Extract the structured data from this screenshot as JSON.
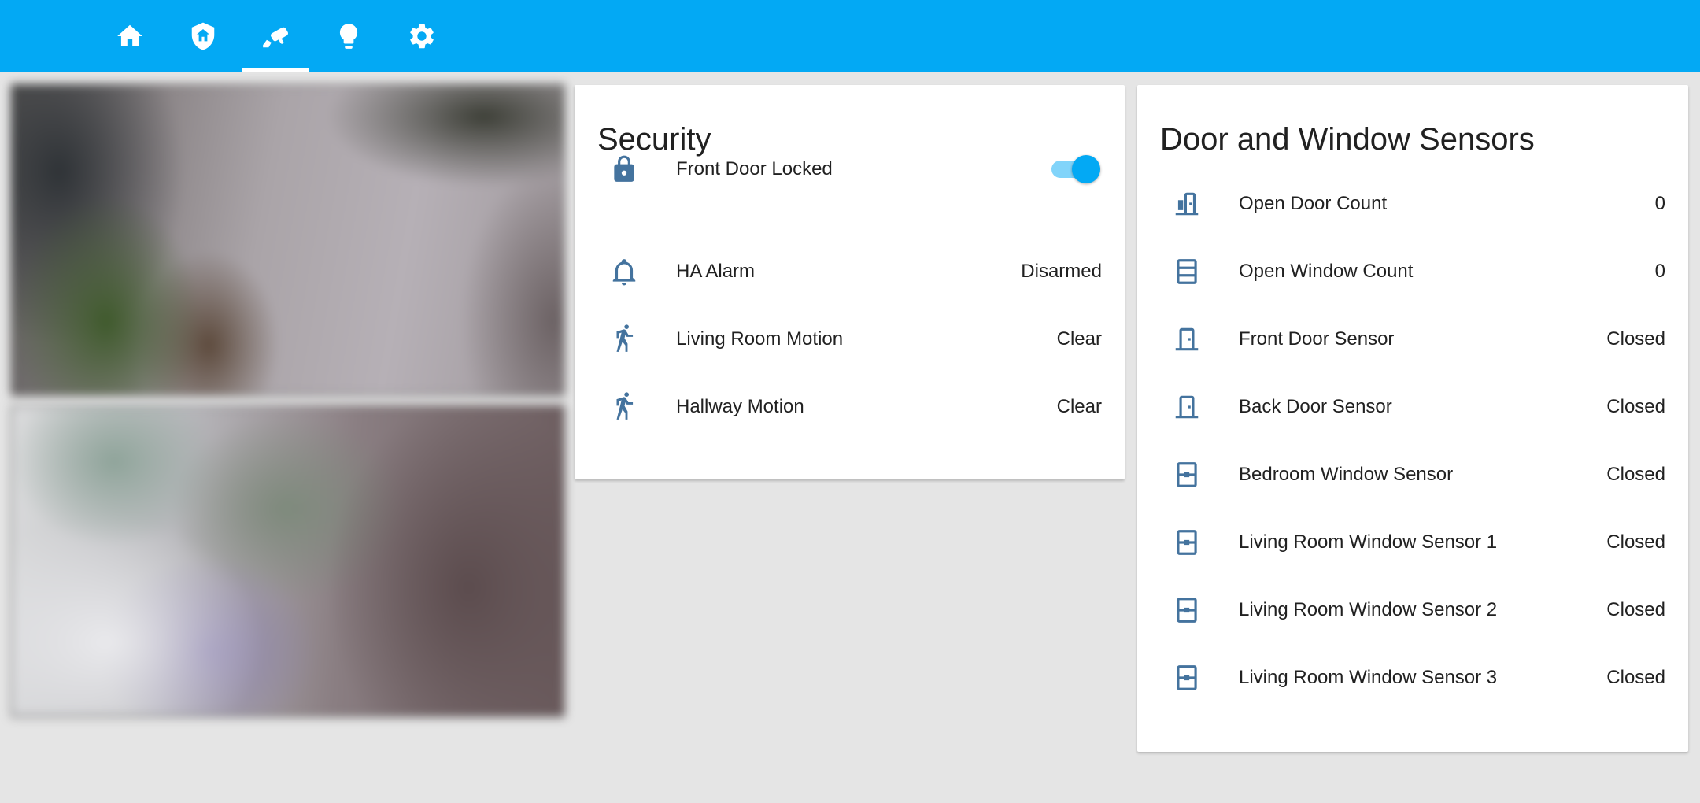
{
  "toolbar": {
    "tabs": [
      {
        "icon": "home-icon"
      },
      {
        "icon": "shield-home-icon"
      },
      {
        "icon": "cctv-icon"
      },
      {
        "icon": "lightbulb-icon"
      },
      {
        "icon": "gear-icon"
      }
    ],
    "active_tab": 2,
    "accent_color": "#03a9f4"
  },
  "cameras": [
    {
      "name": "camera-feed-1"
    },
    {
      "name": "camera-feed-2"
    }
  ],
  "security": {
    "title": "Security",
    "rows": [
      {
        "name": "Front Door Locked",
        "icon": "lock-icon",
        "toggle_on": true
      },
      {
        "name": "HA Alarm",
        "icon": "bell-icon",
        "value": "Disarmed"
      },
      {
        "name": "Living Room Motion",
        "icon": "walk-icon",
        "value": "Clear"
      },
      {
        "name": "Hallway Motion",
        "icon": "walk-icon",
        "value": "Clear"
      }
    ]
  },
  "sensors": {
    "title": "Door and Window Sensors",
    "rows": [
      {
        "name": "Open Door Count",
        "icon": "door-open-icon",
        "value": "0"
      },
      {
        "name": "Open Window Count",
        "icon": "window-icon",
        "value": "0"
      },
      {
        "name": "Front Door Sensor",
        "icon": "door-icon",
        "value": "Closed"
      },
      {
        "name": "Back Door Sensor",
        "icon": "door-icon",
        "value": "Closed"
      },
      {
        "name": "Bedroom Window Sensor",
        "icon": "window-closed-icon",
        "value": "Closed"
      },
      {
        "name": "Living Room Window Sensor 1",
        "icon": "window-closed-icon",
        "value": "Closed"
      },
      {
        "name": "Living Room Window Sensor 2",
        "icon": "window-closed-icon",
        "value": "Closed"
      },
      {
        "name": "Living Room Window Sensor 3",
        "icon": "window-closed-icon",
        "value": "Closed"
      }
    ]
  },
  "icon_color": "#44739e"
}
